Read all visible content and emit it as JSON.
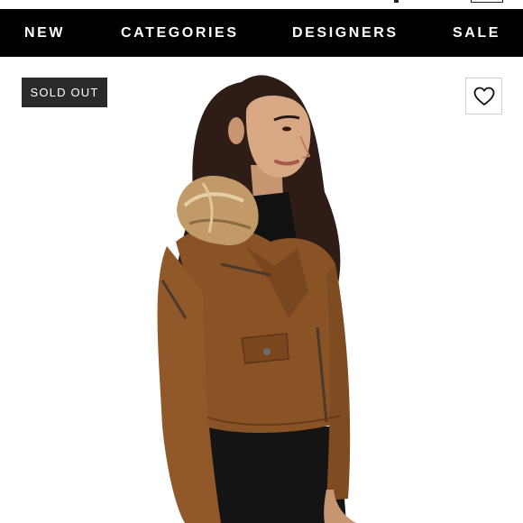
{
  "nav": {
    "items": [
      {
        "label": "NEW"
      },
      {
        "label": "CATEGORIES"
      },
      {
        "label": "DESIGNERS"
      },
      {
        "label": "SALE"
      }
    ]
  },
  "product": {
    "status_badge": "SOLD OUT"
  },
  "icons": {
    "favorite": "heart-outline-icon"
  },
  "colors": {
    "nav_background": "#000000",
    "nav_text": "#ffffff",
    "badge_background": "#2a2a2a",
    "jacket": "#8a5326"
  }
}
